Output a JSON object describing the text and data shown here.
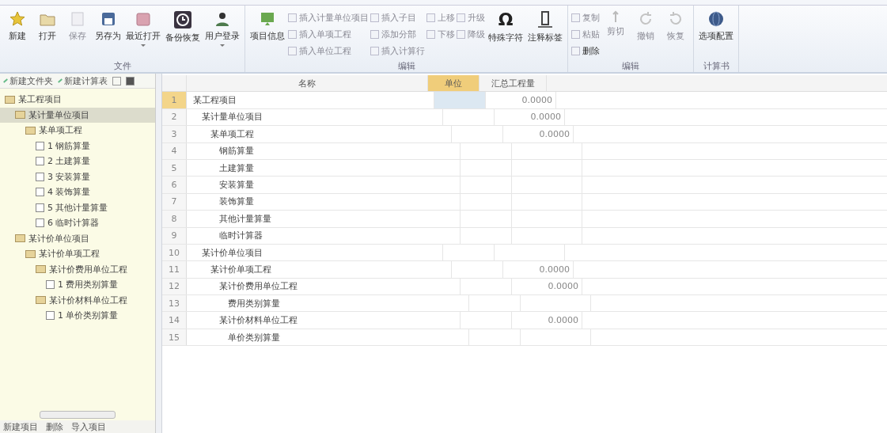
{
  "ribbon": {
    "groups": [
      {
        "label": "文件",
        "items": [
          {
            "kind": "large",
            "label": "新建",
            "disabled": false,
            "dropdown": false
          },
          {
            "kind": "large",
            "label": "打开",
            "disabled": false,
            "dropdown": false
          },
          {
            "kind": "large",
            "label": "保存",
            "disabled": true,
            "dropdown": false
          },
          {
            "kind": "large",
            "label": "另存为",
            "disabled": false,
            "dropdown": false
          },
          {
            "kind": "large",
            "label": "最近打开",
            "disabled": false,
            "dropdown": true
          },
          {
            "kind": "large",
            "label": "备份恢复",
            "disabled": false,
            "dropdown": false
          },
          {
            "kind": "large",
            "label": "用户登录",
            "disabled": false,
            "dropdown": true
          }
        ]
      },
      {
        "label": "编辑",
        "items": [
          {
            "kind": "large",
            "label": "项目信息",
            "disabled": false,
            "dropdown": false
          },
          {
            "kind": "stack",
            "items": [
              {
                "label": "插入计量单位项目",
                "disabled": true
              },
              {
                "label": "插入单项工程",
                "disabled": true
              },
              {
                "label": "插入单位工程",
                "disabled": true
              }
            ]
          },
          {
            "kind": "stack",
            "items": [
              {
                "label": "插入子目",
                "disabled": true
              },
              {
                "label": "添加分部",
                "disabled": true
              },
              {
                "label": "插入计算行",
                "disabled": true
              }
            ]
          },
          {
            "kind": "stack",
            "items": [
              {
                "label": "上移",
                "disabled": true
              },
              {
                "label": "下移",
                "disabled": true
              }
            ]
          },
          {
            "kind": "stack",
            "items": [
              {
                "label": "升级",
                "disabled": true
              },
              {
                "label": "降级",
                "disabled": true
              }
            ]
          },
          {
            "kind": "large",
            "label": "特殊字符",
            "glyph": "Ω",
            "disabled": false,
            "dropdown": false
          },
          {
            "kind": "large",
            "label": "注释标签",
            "disabled": false,
            "dropdown": false
          }
        ]
      },
      {
        "label": "编辑",
        "items": [
          {
            "kind": "stack",
            "items": [
              {
                "label": "复制",
                "disabled": true
              },
              {
                "label": "粘贴",
                "disabled": true
              },
              {
                "label": "删除",
                "disabled": false
              }
            ]
          },
          {
            "kind": "large",
            "label": "剪切",
            "disabled": true,
            "dropdown": false
          },
          {
            "kind": "large",
            "label": "撤销",
            "disabled": true,
            "dropdown": false
          },
          {
            "kind": "large",
            "label": "恢复",
            "disabled": true,
            "dropdown": false
          }
        ]
      },
      {
        "label": "计算书",
        "items": [
          {
            "kind": "large",
            "label": "选项配置",
            "disabled": false,
            "dropdown": false
          }
        ]
      }
    ]
  },
  "sidebar": {
    "toolbar": [
      "新建文件夹",
      "新建计算表"
    ],
    "tree": [
      {
        "label": "某工程项目",
        "kind": "folder",
        "selected": false,
        "children": [
          {
            "label": "某计量单位项目",
            "kind": "folder",
            "selected": true,
            "children": [
              {
                "label": "某单项工程",
                "kind": "folder",
                "selected": false,
                "children": [
                  {
                    "label": "1 钢筋算量",
                    "kind": "sheet",
                    "selected": false
                  },
                  {
                    "label": "2 土建算量",
                    "kind": "sheet",
                    "selected": false
                  },
                  {
                    "label": "3 安装算量",
                    "kind": "sheet",
                    "selected": false
                  },
                  {
                    "label": "4 装饰算量",
                    "kind": "sheet",
                    "selected": false
                  },
                  {
                    "label": "5 其他计量算量",
                    "kind": "sheet",
                    "selected": false
                  },
                  {
                    "label": "6 临时计算器",
                    "kind": "sheet",
                    "selected": false
                  }
                ]
              }
            ]
          },
          {
            "label": "某计价单位项目",
            "kind": "folder",
            "selected": false,
            "children": [
              {
                "label": "某计价单项工程",
                "kind": "folder",
                "selected": false,
                "children": [
                  {
                    "label": "某计价费用单位工程",
                    "kind": "folder",
                    "selected": false,
                    "children": [
                      {
                        "label": "1 费用类别算量",
                        "kind": "sheet",
                        "selected": false
                      }
                    ]
                  },
                  {
                    "label": "某计价材料单位工程",
                    "kind": "folder",
                    "selected": false,
                    "children": [
                      {
                        "label": "1 单价类别算量",
                        "kind": "sheet",
                        "selected": false
                      }
                    ]
                  }
                ]
              }
            ]
          }
        ]
      }
    ],
    "bottom_toolbar": [
      "新建项目",
      "删除",
      "导入项目"
    ]
  },
  "table": {
    "columns": [
      "名称",
      "单位",
      "汇总工程量"
    ],
    "rows": [
      {
        "no": "1",
        "name": "某工程项目",
        "total": "0.0000",
        "selected": true,
        "children": [
          {
            "no": "2",
            "name": "某计量单位项目",
            "total": "0.0000",
            "selected": false,
            "children": [
              {
                "no": "3",
                "name": "某单项工程",
                "total": "0.0000",
                "selected": false,
                "children": [
                  {
                    "no": "4",
                    "name": "钢筋算量",
                    "selected": false
                  },
                  {
                    "no": "5",
                    "name": "土建算量",
                    "selected": false
                  },
                  {
                    "no": "6",
                    "name": "安装算量",
                    "selected": false
                  },
                  {
                    "no": "7",
                    "name": "装饰算量",
                    "selected": false
                  },
                  {
                    "no": "8",
                    "name": "其他计量算量",
                    "selected": false
                  },
                  {
                    "no": "9",
                    "name": "临时计算器",
                    "selected": false
                  }
                ]
              }
            ]
          },
          {
            "no": "10",
            "name": "某计价单位项目",
            "selected": false,
            "children": [
              {
                "no": "11",
                "name": "某计价单项工程",
                "total": "0.0000",
                "selected": false,
                "children": [
                  {
                    "no": "12",
                    "name": "某计价费用单位工程",
                    "total": "0.0000",
                    "selected": false,
                    "children": [
                      {
                        "no": "13",
                        "name": "费用类别算量",
                        "selected": false
                      }
                    ]
                  },
                  {
                    "no": "14",
                    "name": "某计价材料单位工程",
                    "total": "0.0000",
                    "selected": false,
                    "children": [
                      {
                        "no": "15",
                        "name": "单价类别算量",
                        "selected": false
                      }
                    ]
                  }
                ]
              }
            ]
          }
        ]
      }
    ]
  }
}
